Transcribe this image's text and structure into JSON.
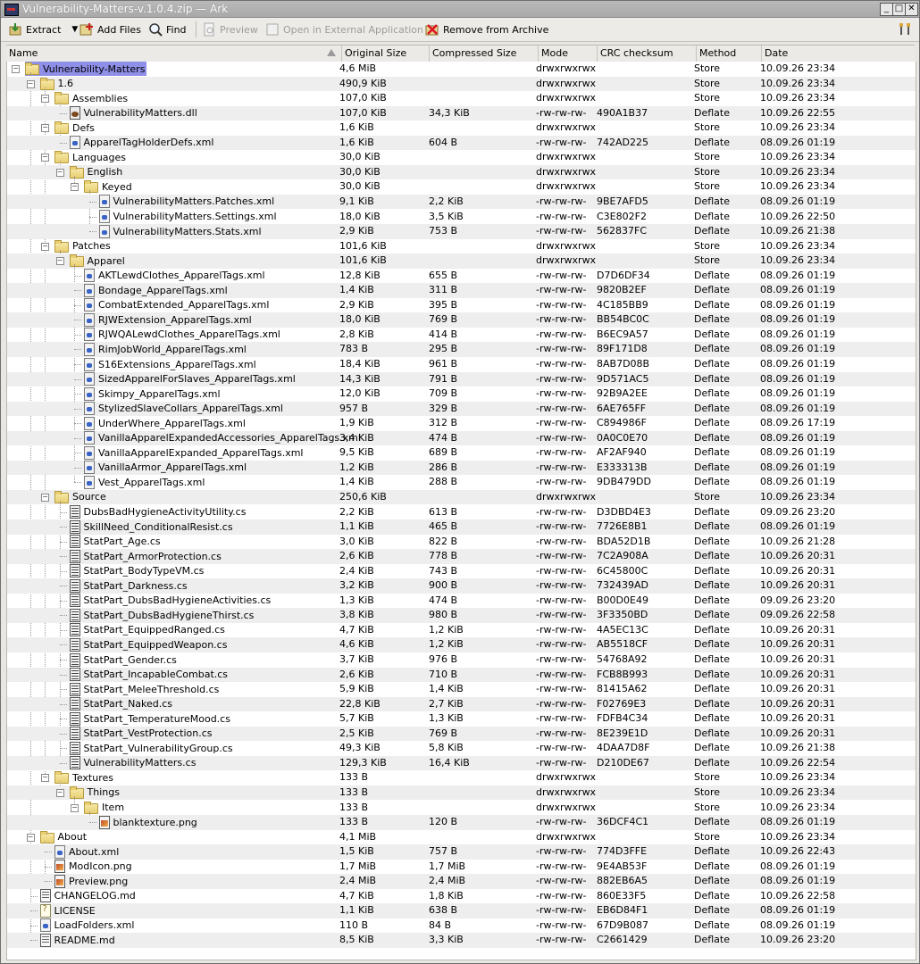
{
  "window": {
    "title": "Vulnerability-Matters-v.1.0.4.zip — Ark",
    "buttons": [
      "_",
      "□",
      "✕"
    ]
  },
  "toolbar": {
    "extract": "Extract",
    "add_files": "Add Files",
    "find": "Find",
    "preview": "Preview",
    "open_external": "Open in External Application",
    "remove": "Remove from Archive"
  },
  "columns": [
    "Name",
    "Original Size",
    "Compressed Size",
    "Mode",
    "CRC checksum",
    "Method",
    "Date"
  ],
  "rows": [
    {
      "name": "Vulnerability-Matters",
      "type": "folder",
      "depth": 0,
      "orig": "4,6 MiB",
      "comp": "",
      "mode": "drwxrwxrwx",
      "crc": "",
      "method": "Store",
      "date": "10.09.26 23:34"
    },
    {
      "name": "1.6",
      "type": "folder",
      "depth": 1,
      "orig": "490,9 KiB",
      "comp": "",
      "mode": "drwxrwxrwx",
      "crc": "",
      "method": "Store",
      "date": "10.09.26 23:34"
    },
    {
      "name": "Assemblies",
      "type": "folder",
      "depth": 2,
      "orig": "107,0 KiB",
      "comp": "",
      "mode": "drwxrwxrwx",
      "crc": "",
      "method": "Store",
      "date": "10.09.26 23:34"
    },
    {
      "name": "VulnerabilityMatters.dll",
      "type": "dll",
      "depth": 3,
      "orig": "107,0 KiB",
      "comp": "34,3 KiB",
      "mode": "-rw-rw-rw-",
      "crc": "490A1B37",
      "method": "Deflate",
      "date": "10.09.26 22:55"
    },
    {
      "name": "Defs",
      "type": "folder",
      "depth": 2,
      "orig": "1,6 KiB",
      "comp": "",
      "mode": "drwxrwxrwx",
      "crc": "",
      "method": "Store",
      "date": "10.09.26 23:34"
    },
    {
      "name": "ApparelTagHolderDefs.xml",
      "type": "xml",
      "depth": 3,
      "orig": "1,6 KiB",
      "comp": "604 B",
      "mode": "-rw-rw-rw-",
      "crc": "742AD225",
      "method": "Deflate",
      "date": "08.09.26 01:19"
    },
    {
      "name": "Languages",
      "type": "folder",
      "depth": 2,
      "orig": "30,0 KiB",
      "comp": "",
      "mode": "drwxrwxrwx",
      "crc": "",
      "method": "Store",
      "date": "10.09.26 23:34"
    },
    {
      "name": "English",
      "type": "folder",
      "depth": 3,
      "orig": "30,0 KiB",
      "comp": "",
      "mode": "drwxrwxrwx",
      "crc": "",
      "method": "Store",
      "date": "10.09.26 23:34"
    },
    {
      "name": "Keyed",
      "type": "folder",
      "depth": 4,
      "orig": "30,0 KiB",
      "comp": "",
      "mode": "drwxrwxrwx",
      "crc": "",
      "method": "Store",
      "date": "10.09.26 23:34"
    },
    {
      "name": "VulnerabilityMatters.Patches.xml",
      "type": "xml",
      "depth": 5,
      "orig": "9,1 KiB",
      "comp": "2,2 KiB",
      "mode": "-rw-rw-rw-",
      "crc": "9BE7AFD5",
      "method": "Deflate",
      "date": "08.09.26 01:19"
    },
    {
      "name": "VulnerabilityMatters.Settings.xml",
      "type": "xml",
      "depth": 5,
      "orig": "18,0 KiB",
      "comp": "3,5 KiB",
      "mode": "-rw-rw-rw-",
      "crc": "C3E802F2",
      "method": "Deflate",
      "date": "10.09.26 22:50"
    },
    {
      "name": "VulnerabilityMatters.Stats.xml",
      "type": "xml",
      "depth": 5,
      "orig": "2,9 KiB",
      "comp": "753 B",
      "mode": "-rw-rw-rw-",
      "crc": "562837FC",
      "method": "Deflate",
      "date": "10.09.26 21:38"
    },
    {
      "name": "Patches",
      "type": "folder",
      "depth": 2,
      "orig": "101,6 KiB",
      "comp": "",
      "mode": "drwxrwxrwx",
      "crc": "",
      "method": "Store",
      "date": "10.09.26 23:34"
    },
    {
      "name": "Apparel",
      "type": "folder",
      "depth": 3,
      "orig": "101,6 KiB",
      "comp": "",
      "mode": "drwxrwxrwx",
      "crc": "",
      "method": "Store",
      "date": "10.09.26 23:34"
    },
    {
      "name": "AKTLewdClothes_ApparelTags.xml",
      "type": "xml",
      "depth": 4,
      "orig": "12,8 KiB",
      "comp": "655 B",
      "mode": "-rw-rw-rw-",
      "crc": "D7D6DF34",
      "method": "Deflate",
      "date": "08.09.26 01:19"
    },
    {
      "name": "Bondage_ApparelTags.xml",
      "type": "xml",
      "depth": 4,
      "orig": "1,4 KiB",
      "comp": "311 B",
      "mode": "-rw-rw-rw-",
      "crc": "9820B2EF",
      "method": "Deflate",
      "date": "08.09.26 01:19"
    },
    {
      "name": "CombatExtended_ApparelTags.xml",
      "type": "xml",
      "depth": 4,
      "orig": "2,9 KiB",
      "comp": "395 B",
      "mode": "-rw-rw-rw-",
      "crc": "4C185BB9",
      "method": "Deflate",
      "date": "08.09.26 01:19"
    },
    {
      "name": "RJWExtension_ApparelTags.xml",
      "type": "xml",
      "depth": 4,
      "orig": "18,0 KiB",
      "comp": "769 B",
      "mode": "-rw-rw-rw-",
      "crc": "BB54BC0C",
      "method": "Deflate",
      "date": "08.09.26 01:19"
    },
    {
      "name": "RJWQALewdClothes_ApparelTags.xml",
      "type": "xml",
      "depth": 4,
      "orig": "2,8 KiB",
      "comp": "414 B",
      "mode": "-rw-rw-rw-",
      "crc": "B6EC9A57",
      "method": "Deflate",
      "date": "08.09.26 01:19"
    },
    {
      "name": "RimJobWorld_ApparelTags.xml",
      "type": "xml",
      "depth": 4,
      "orig": "783 B",
      "comp": "295 B",
      "mode": "-rw-rw-rw-",
      "crc": "89F171D8",
      "method": "Deflate",
      "date": "08.09.26 01:19"
    },
    {
      "name": "S16Extensions_ApparelTags.xml",
      "type": "xml",
      "depth": 4,
      "orig": "18,4 KiB",
      "comp": "961 B",
      "mode": "-rw-rw-rw-",
      "crc": "8AB7D08B",
      "method": "Deflate",
      "date": "08.09.26 01:19"
    },
    {
      "name": "SizedApparelForSlaves_ApparelTags.xml",
      "type": "xml",
      "depth": 4,
      "orig": "14,3 KiB",
      "comp": "791 B",
      "mode": "-rw-rw-rw-",
      "crc": "9D571AC5",
      "method": "Deflate",
      "date": "08.09.26 01:19"
    },
    {
      "name": "Skimpy_ApparelTags.xml",
      "type": "xml",
      "depth": 4,
      "orig": "12,0 KiB",
      "comp": "709 B",
      "mode": "-rw-rw-rw-",
      "crc": "92B9A2EE",
      "method": "Deflate",
      "date": "08.09.26 01:19"
    },
    {
      "name": "StylizedSlaveCollars_ApparelTags.xml",
      "type": "xml",
      "depth": 4,
      "orig": "957 B",
      "comp": "329 B",
      "mode": "-rw-rw-rw-",
      "crc": "6AE765FF",
      "method": "Deflate",
      "date": "08.09.26 01:19"
    },
    {
      "name": "UnderWhere_ApparelTags.xml",
      "type": "xml",
      "depth": 4,
      "orig": "1,9 KiB",
      "comp": "312 B",
      "mode": "-rw-rw-rw-",
      "crc": "C894986F",
      "method": "Deflate",
      "date": "08.09.26 17:19"
    },
    {
      "name": "VanillaApparelExpandedAccessories_ApparelTags.xml",
      "type": "xml",
      "depth": 4,
      "orig": "3,4 KiB",
      "comp": "474 B",
      "mode": "-rw-rw-rw-",
      "crc": "0A0C0E70",
      "method": "Deflate",
      "date": "08.09.26 01:19"
    },
    {
      "name": "VanillaApparelExpanded_ApparelTags.xml",
      "type": "xml",
      "depth": 4,
      "orig": "9,5 KiB",
      "comp": "689 B",
      "mode": "-rw-rw-rw-",
      "crc": "AF2AF940",
      "method": "Deflate",
      "date": "08.09.26 01:19"
    },
    {
      "name": "VanillaArmor_ApparelTags.xml",
      "type": "xml",
      "depth": 4,
      "orig": "1,2 KiB",
      "comp": "286 B",
      "mode": "-rw-rw-rw-",
      "crc": "E333313B",
      "method": "Deflate",
      "date": "08.09.26 01:19"
    },
    {
      "name": "Vest_ApparelTags.xml",
      "type": "xml",
      "depth": 4,
      "orig": "1,4 KiB",
      "comp": "288 B",
      "mode": "-rw-rw-rw-",
      "crc": "9DB479DD",
      "method": "Deflate",
      "date": "08.09.26 01:19"
    },
    {
      "name": "Source",
      "type": "folder",
      "depth": 2,
      "orig": "250,6 KiB",
      "comp": "",
      "mode": "drwxrwxrwx",
      "crc": "",
      "method": "Store",
      "date": "10.09.26 23:34"
    },
    {
      "name": "DubsBadHygieneActivityUtility.cs",
      "type": "cs",
      "depth": 3,
      "orig": "2,2 KiB",
      "comp": "613 B",
      "mode": "-rw-rw-rw-",
      "crc": "D3DBD4E3",
      "method": "Deflate",
      "date": "09.09.26 23:20"
    },
    {
      "name": "SkillNeed_ConditionalResist.cs",
      "type": "cs",
      "depth": 3,
      "orig": "1,1 KiB",
      "comp": "465 B",
      "mode": "-rw-rw-rw-",
      "crc": "7726E8B1",
      "method": "Deflate",
      "date": "08.09.26 01:19"
    },
    {
      "name": "StatPart_Age.cs",
      "type": "cs",
      "depth": 3,
      "orig": "3,0 KiB",
      "comp": "822 B",
      "mode": "-rw-rw-rw-",
      "crc": "BDA52D1B",
      "method": "Deflate",
      "date": "10.09.26 21:28"
    },
    {
      "name": "StatPart_ArmorProtection.cs",
      "type": "cs",
      "depth": 3,
      "orig": "2,6 KiB",
      "comp": "778 B",
      "mode": "-rw-rw-rw-",
      "crc": "7C2A908A",
      "method": "Deflate",
      "date": "10.09.26 20:31"
    },
    {
      "name": "StatPart_BodyTypeVM.cs",
      "type": "cs",
      "depth": 3,
      "orig": "2,4 KiB",
      "comp": "743 B",
      "mode": "-rw-rw-rw-",
      "crc": "6C45800C",
      "method": "Deflate",
      "date": "10.09.26 20:31"
    },
    {
      "name": "StatPart_Darkness.cs",
      "type": "cs",
      "depth": 3,
      "orig": "3,2 KiB",
      "comp": "900 B",
      "mode": "-rw-rw-rw-",
      "crc": "732439AD",
      "method": "Deflate",
      "date": "10.09.26 20:31"
    },
    {
      "name": "StatPart_DubsBadHygieneActivities.cs",
      "type": "cs",
      "depth": 3,
      "orig": "1,3 KiB",
      "comp": "474 B",
      "mode": "-rw-rw-rw-",
      "crc": "B00D0E49",
      "method": "Deflate",
      "date": "09.09.26 23:20"
    },
    {
      "name": "StatPart_DubsBadHygieneThirst.cs",
      "type": "cs",
      "depth": 3,
      "orig": "3,8 KiB",
      "comp": "980 B",
      "mode": "-rw-rw-rw-",
      "crc": "3F3350BD",
      "method": "Deflate",
      "date": "09.09.26 22:58"
    },
    {
      "name": "StatPart_EquippedRanged.cs",
      "type": "cs",
      "depth": 3,
      "orig": "4,7 KiB",
      "comp": "1,2 KiB",
      "mode": "-rw-rw-rw-",
      "crc": "4A5EC13C",
      "method": "Deflate",
      "date": "10.09.26 20:31"
    },
    {
      "name": "StatPart_EquippedWeapon.cs",
      "type": "cs",
      "depth": 3,
      "orig": "4,6 KiB",
      "comp": "1,2 KiB",
      "mode": "-rw-rw-rw-",
      "crc": "AB5518CF",
      "method": "Deflate",
      "date": "10.09.26 20:31"
    },
    {
      "name": "StatPart_Gender.cs",
      "type": "cs",
      "depth": 3,
      "orig": "3,7 KiB",
      "comp": "976 B",
      "mode": "-rw-rw-rw-",
      "crc": "54768A92",
      "method": "Deflate",
      "date": "10.09.26 20:31"
    },
    {
      "name": "StatPart_IncapableCombat.cs",
      "type": "cs",
      "depth": 3,
      "orig": "2,6 KiB",
      "comp": "710 B",
      "mode": "-rw-rw-rw-",
      "crc": "FCB8B993",
      "method": "Deflate",
      "date": "10.09.26 20:31"
    },
    {
      "name": "StatPart_MeleeThreshold.cs",
      "type": "cs",
      "depth": 3,
      "orig": "5,9 KiB",
      "comp": "1,4 KiB",
      "mode": "-rw-rw-rw-",
      "crc": "81415A62",
      "method": "Deflate",
      "date": "10.09.26 20:31"
    },
    {
      "name": "StatPart_Naked.cs",
      "type": "cs",
      "depth": 3,
      "orig": "22,8 KiB",
      "comp": "2,7 KiB",
      "mode": "-rw-rw-rw-",
      "crc": "F02769E3",
      "method": "Deflate",
      "date": "10.09.26 20:31"
    },
    {
      "name": "StatPart_TemperatureMood.cs",
      "type": "cs",
      "depth": 3,
      "orig": "5,7 KiB",
      "comp": "1,3 KiB",
      "mode": "-rw-rw-rw-",
      "crc": "FDFB4C34",
      "method": "Deflate",
      "date": "10.09.26 20:31"
    },
    {
      "name": "StatPart_VestProtection.cs",
      "type": "cs",
      "depth": 3,
      "orig": "2,5 KiB",
      "comp": "769 B",
      "mode": "-rw-rw-rw-",
      "crc": "8E239E1D",
      "method": "Deflate",
      "date": "10.09.26 20:31"
    },
    {
      "name": "StatPart_VulnerabilityGroup.cs",
      "type": "cs",
      "depth": 3,
      "orig": "49,3 KiB",
      "comp": "5,8 KiB",
      "mode": "-rw-rw-rw-",
      "crc": "4DAA7D8F",
      "method": "Deflate",
      "date": "10.09.26 21:38"
    },
    {
      "name": "VulnerabilityMatters.cs",
      "type": "cs",
      "depth": 3,
      "orig": "129,3 KiB",
      "comp": "16,4 KiB",
      "mode": "-rw-rw-rw-",
      "crc": "D210DE67",
      "method": "Deflate",
      "date": "10.09.26 22:54"
    },
    {
      "name": "Textures",
      "type": "folder",
      "depth": 2,
      "orig": "133 B",
      "comp": "",
      "mode": "drwxrwxrwx",
      "crc": "",
      "method": "Store",
      "date": "10.09.26 23:34"
    },
    {
      "name": "Things",
      "type": "folder",
      "depth": 3,
      "orig": "133 B",
      "comp": "",
      "mode": "drwxrwxrwx",
      "crc": "",
      "method": "Store",
      "date": "10.09.26 23:34"
    },
    {
      "name": "Item",
      "type": "folder",
      "depth": 4,
      "orig": "133 B",
      "comp": "",
      "mode": "drwxrwxrwx",
      "crc": "",
      "method": "Store",
      "date": "10.09.26 23:34"
    },
    {
      "name": "blanktexture.png",
      "type": "img",
      "depth": 5,
      "orig": "133 B",
      "comp": "120 B",
      "mode": "-rw-rw-rw-",
      "crc": "36DCF4C1",
      "method": "Deflate",
      "date": "08.09.26 01:19"
    },
    {
      "name": "About",
      "type": "folder",
      "depth": 1,
      "orig": "4,1 MiB",
      "comp": "",
      "mode": "drwxrwxrwx",
      "crc": "",
      "method": "Store",
      "date": "10.09.26 23:34"
    },
    {
      "name": "About.xml",
      "type": "xml",
      "depth": 2,
      "orig": "1,5 KiB",
      "comp": "757 B",
      "mode": "-rw-rw-rw-",
      "crc": "774D3FFE",
      "method": "Deflate",
      "date": "10.09.26 22:43"
    },
    {
      "name": "ModIcon.png",
      "type": "img",
      "depth": 2,
      "orig": "1,7 MiB",
      "comp": "1,7 MiB",
      "mode": "-rw-rw-rw-",
      "crc": "9E4AB53F",
      "method": "Deflate",
      "date": "08.09.26 01:19"
    },
    {
      "name": "Preview.png",
      "type": "img",
      "depth": 2,
      "orig": "2,4 MiB",
      "comp": "2,4 MiB",
      "mode": "-rw-rw-rw-",
      "crc": "882EB6A5",
      "method": "Deflate",
      "date": "08.09.26 01:19"
    },
    {
      "name": "CHANGELOG.md",
      "type": "txt",
      "depth": 1,
      "orig": "4,7 KiB",
      "comp": "1,8 KiB",
      "mode": "-rw-rw-rw-",
      "crc": "860E33F5",
      "method": "Deflate",
      "date": "10.09.26 22:58"
    },
    {
      "name": "LICENSE",
      "type": "lic",
      "depth": 1,
      "orig": "1,1 KiB",
      "comp": "638 B",
      "mode": "-rw-rw-rw-",
      "crc": "EB6D84F1",
      "method": "Deflate",
      "date": "08.09.26 01:19"
    },
    {
      "name": "LoadFolders.xml",
      "type": "xml",
      "depth": 1,
      "orig": "110 B",
      "comp": "84 B",
      "mode": "-rw-rw-rw-",
      "crc": "67D9B087",
      "method": "Deflate",
      "date": "08.09.26 01:19"
    },
    {
      "name": "README.md",
      "type": "txt",
      "depth": 1,
      "orig": "8,5 KiB",
      "comp": "3,3 KiB",
      "mode": "-rw-rw-rw-",
      "crc": "C2661429",
      "method": "Deflate",
      "date": "10.09.26 23:20"
    }
  ]
}
